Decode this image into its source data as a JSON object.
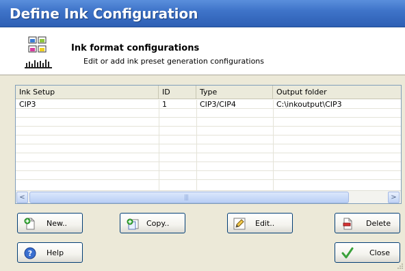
{
  "window": {
    "title": "Define Ink Configuration"
  },
  "header": {
    "title": "Ink format configurations",
    "subtitle": "Edit or add ink preset generation configurations",
    "icon": "ink-config-icon"
  },
  "table": {
    "columns": [
      "Ink Setup",
      "ID",
      "Type",
      "Output folder"
    ],
    "rows": [
      {
        "ink_setup": "CIP3",
        "id": "1",
        "type": "CIP3/CIP4",
        "output_folder": "C:\\inkoutput\\CIP3"
      }
    ]
  },
  "scrollbar": {
    "left_arrow": "<",
    "right_arrow": ">"
  },
  "buttons": {
    "new": "New..",
    "copy": "Copy..",
    "edit": "Edit..",
    "delete": "Delete",
    "help": "Help",
    "close": "Close"
  },
  "colors": {
    "title_bar": "#3f74c9",
    "border": "#003c74",
    "check_green": "#3aa13a"
  }
}
